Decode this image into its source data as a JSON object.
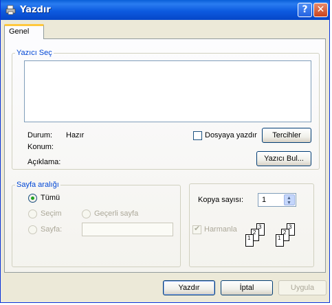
{
  "window": {
    "title": "Yazdır",
    "help_label": "?",
    "close_label": "✕"
  },
  "tabs": [
    {
      "label": "Genel",
      "active": true
    }
  ],
  "printer_group": {
    "legend": "Yazıcı Seç",
    "status_label": "Durum:",
    "status_value": "Hazır",
    "location_label": "Konum:",
    "comment_label": "Açıklama:",
    "print_to_file_label": "Dosyaya yazdır",
    "preferences_button": "Tercihler",
    "find_printer_button": "Yazıcı Bul..."
  },
  "range_group": {
    "legend": "Sayfa aralığı",
    "all_label": "Tümü",
    "selection_label": "Seçim",
    "current_page_label": "Geçerli sayfa",
    "pages_label": "Sayfa:",
    "pages_value": ""
  },
  "copies_group": {
    "copies_label": "Kopya sayısı:",
    "copies_value": "1",
    "collate_label": "Harmanla",
    "collate_checked": true,
    "pages_stack_1": [
      "1",
      "2",
      "3"
    ],
    "pages_stack_2": [
      "1",
      "2",
      "3"
    ]
  },
  "footer": {
    "print_button": "Yazdır",
    "cancel_button": "İptal",
    "apply_button": "Uygula"
  },
  "colors": {
    "titlebar": "#0a5fd8",
    "legend_text": "#0046d5",
    "dialog_bg": "#ece9d8",
    "radio_dot": "#21a121"
  }
}
